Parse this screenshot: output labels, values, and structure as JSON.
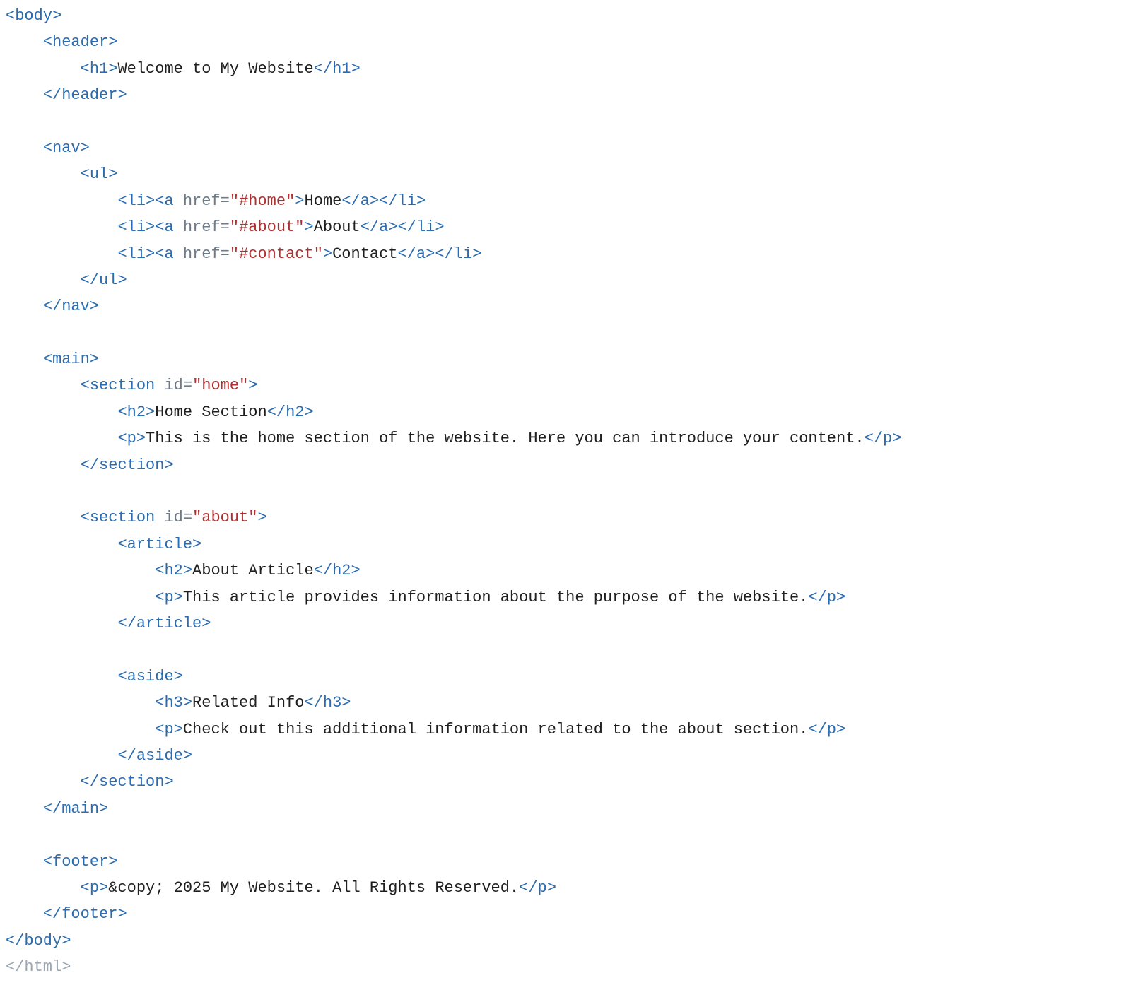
{
  "lines": [
    {
      "indent": 0,
      "kind": "open",
      "tag": "body"
    },
    {
      "indent": 1,
      "kind": "open",
      "tag": "header"
    },
    {
      "indent": 2,
      "kind": "wrap",
      "tag": "h1",
      "text": "Welcome to My Website"
    },
    {
      "indent": 1,
      "kind": "close",
      "tag": "header"
    },
    {
      "indent": 0,
      "kind": "blank"
    },
    {
      "indent": 1,
      "kind": "open",
      "tag": "nav"
    },
    {
      "indent": 2,
      "kind": "open",
      "tag": "ul"
    },
    {
      "indent": 3,
      "kind": "li",
      "href": "#home",
      "text": "Home"
    },
    {
      "indent": 3,
      "kind": "li",
      "href": "#about",
      "text": "About"
    },
    {
      "indent": 3,
      "kind": "li",
      "href": "#contact",
      "text": "Contact"
    },
    {
      "indent": 2,
      "kind": "close",
      "tag": "ul"
    },
    {
      "indent": 1,
      "kind": "close",
      "tag": "nav"
    },
    {
      "indent": 0,
      "kind": "blank"
    },
    {
      "indent": 1,
      "kind": "open",
      "tag": "main"
    },
    {
      "indent": 2,
      "kind": "open",
      "tag": "section",
      "attrName": "id",
      "attrValue": "home"
    },
    {
      "indent": 3,
      "kind": "wrap",
      "tag": "h2",
      "text": "Home Section"
    },
    {
      "indent": 3,
      "kind": "wrap",
      "tag": "p",
      "text": "This is the home section of the website. Here you can introduce your content."
    },
    {
      "indent": 2,
      "kind": "close",
      "tag": "section"
    },
    {
      "indent": 0,
      "kind": "blank"
    },
    {
      "indent": 2,
      "kind": "open",
      "tag": "section",
      "attrName": "id",
      "attrValue": "about"
    },
    {
      "indent": 3,
      "kind": "open",
      "tag": "article"
    },
    {
      "indent": 4,
      "kind": "wrap",
      "tag": "h2",
      "text": "About Article"
    },
    {
      "indent": 4,
      "kind": "wrap",
      "tag": "p",
      "text": "This article provides information about the purpose of the website."
    },
    {
      "indent": 3,
      "kind": "close",
      "tag": "article"
    },
    {
      "indent": 0,
      "kind": "blank"
    },
    {
      "indent": 3,
      "kind": "open",
      "tag": "aside"
    },
    {
      "indent": 4,
      "kind": "wrap",
      "tag": "h3",
      "text": "Related Info"
    },
    {
      "indent": 4,
      "kind": "wrap",
      "tag": "p",
      "text": "Check out this additional information related to the about section."
    },
    {
      "indent": 3,
      "kind": "close",
      "tag": "aside"
    },
    {
      "indent": 2,
      "kind": "close",
      "tag": "section"
    },
    {
      "indent": 1,
      "kind": "close",
      "tag": "main"
    },
    {
      "indent": 0,
      "kind": "blank"
    },
    {
      "indent": 1,
      "kind": "open",
      "tag": "footer"
    },
    {
      "indent": 2,
      "kind": "pcopy",
      "text": " 2025 My Website. All Rights Reserved."
    },
    {
      "indent": 1,
      "kind": "close",
      "tag": "footer"
    },
    {
      "indent": 0,
      "kind": "close",
      "tag": "body"
    },
    {
      "indent": 0,
      "kind": "close",
      "tag": "html",
      "faded": true
    }
  ],
  "indentUnit": "    "
}
